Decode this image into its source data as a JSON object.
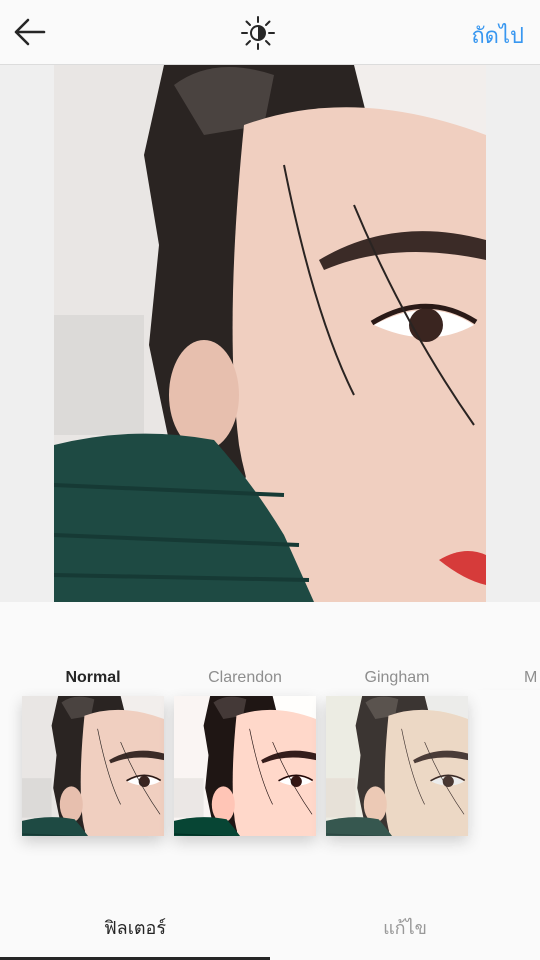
{
  "header": {
    "next_label": "ถัดไป"
  },
  "icons": {
    "back": "back-arrow-icon",
    "lux": "lux-sun-icon"
  },
  "filters": [
    {
      "label": "Normal",
      "selected": true
    },
    {
      "label": "Clarendon",
      "selected": false
    },
    {
      "label": "Gingham",
      "selected": false
    },
    {
      "label": "M",
      "selected": false
    }
  ],
  "tabs": [
    {
      "label": "ฟิลเตอร์",
      "active": true
    },
    {
      "label": "แก้ไข",
      "active": false
    }
  ],
  "colors": {
    "accent": "#3897f0",
    "background": "#fafafa",
    "text_dark": "#262626",
    "text_muted": "#8e8e8e"
  }
}
